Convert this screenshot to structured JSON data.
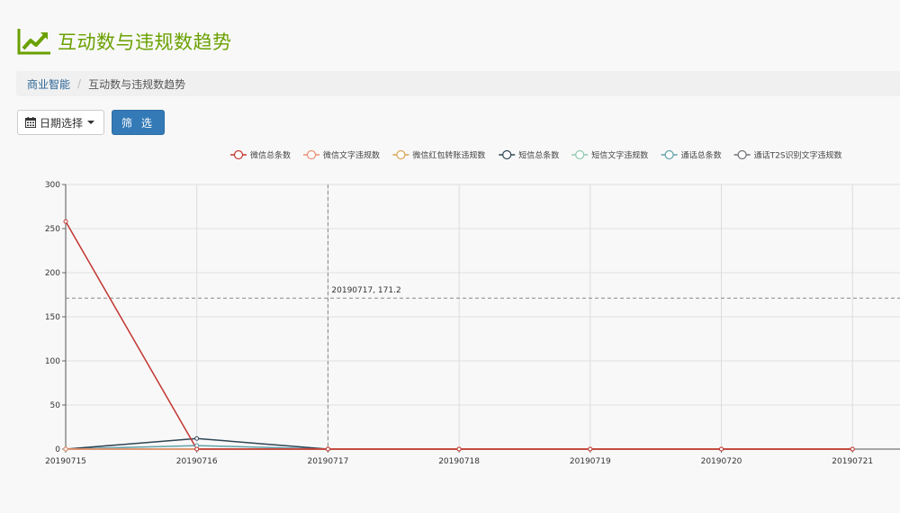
{
  "page": {
    "title": "互动数与违规数趋势"
  },
  "breadcrumb": {
    "home": "商业智能",
    "separator": "/",
    "current": "互动数与违规数趋势"
  },
  "toolbar": {
    "date_label": "日期选择",
    "filter_label": "筛 选"
  },
  "tooltip": {
    "label": "20190717, 171.2"
  },
  "colors": {
    "title_green": "#6aa100",
    "primary_button": "#337ab7"
  },
  "chart_data": {
    "type": "line",
    "categories": [
      "20190715",
      "20190716",
      "20190717",
      "20190718",
      "20190719",
      "20190720",
      "20190721"
    ],
    "ylim": [
      0,
      300
    ],
    "yticks": [
      0,
      50,
      100,
      150,
      200,
      250,
      300
    ],
    "grid": true,
    "legend_position": "top",
    "crosshair": {
      "x": "20190717",
      "y": 171.2
    },
    "series": [
      {
        "name": "微信总条数",
        "color": "#c23531",
        "values": [
          258,
          0,
          0,
          0,
          0,
          0,
          0
        ]
      },
      {
        "name": "微信文字违规数",
        "color": "#e98f6f",
        "values": [
          0,
          0,
          0,
          0,
          0,
          0,
          0
        ]
      },
      {
        "name": "微信红包转账违规数",
        "color": "#d8a355",
        "values": [
          0,
          0,
          0,
          0,
          0,
          0,
          0
        ]
      },
      {
        "name": "短信总条数",
        "color": "#2f4554",
        "values": [
          0,
          12,
          0,
          0,
          0,
          0,
          0
        ]
      },
      {
        "name": "短信文字违规数",
        "color": "#91c7ae",
        "values": [
          0,
          0,
          0,
          0,
          0,
          0,
          0
        ]
      },
      {
        "name": "通话总条数",
        "color": "#61a0a8",
        "values": [
          0,
          4,
          0,
          0,
          0,
          0,
          0
        ]
      },
      {
        "name": "通话T2S识别文字违规数",
        "color": "#6e7074",
        "values": [
          0,
          0,
          0,
          0,
          0,
          0,
          0
        ]
      }
    ]
  }
}
